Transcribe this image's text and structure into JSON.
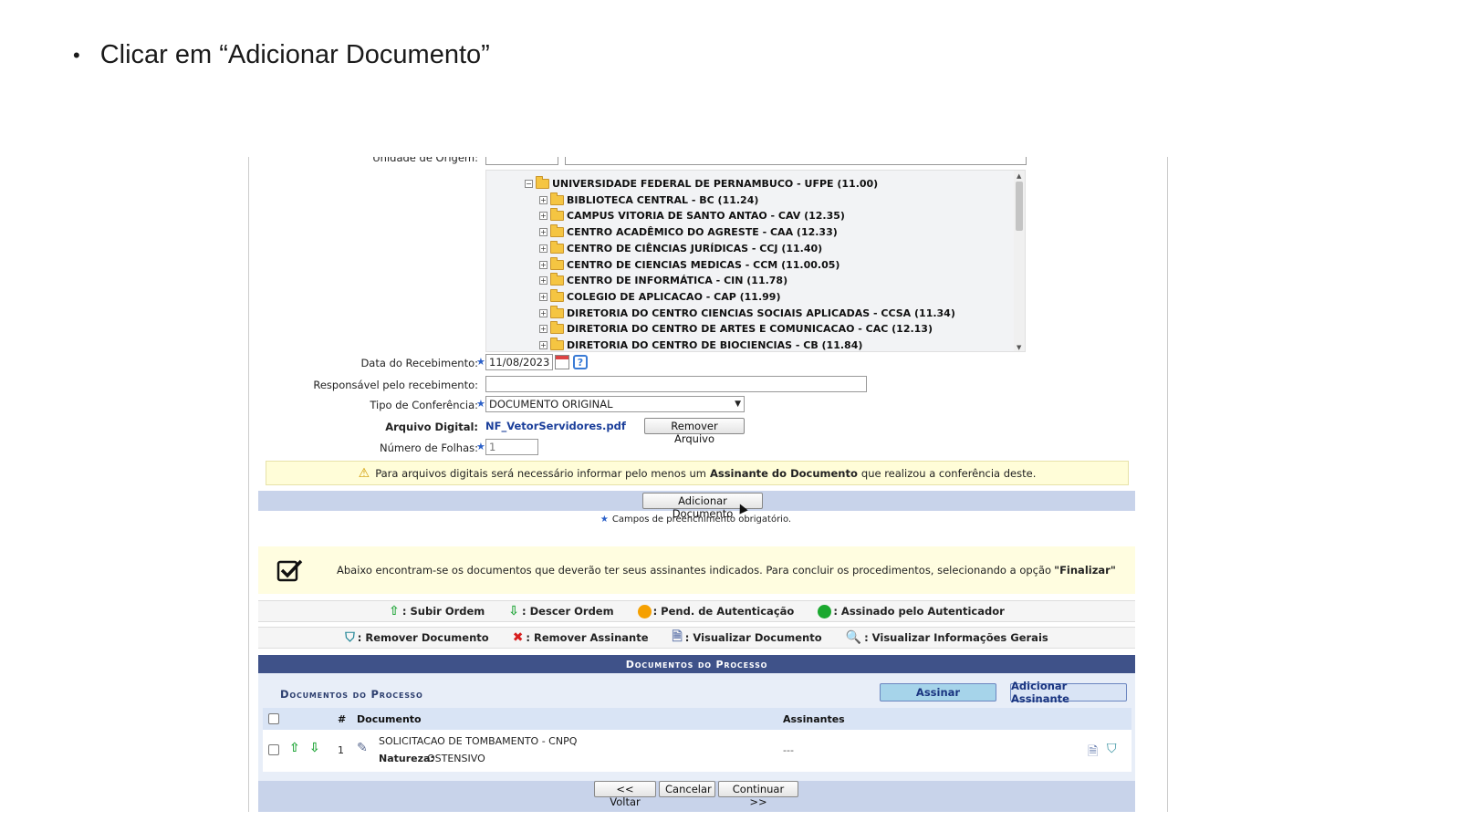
{
  "slide": {
    "bullet_text": "Clicar em “Adicionar Documento”"
  },
  "form": {
    "unidade_origem_label": "Unidade de Origem:",
    "tree": [
      {
        "label": "UNIVERSIDADE FEDERAL DE PERNAMBUCO - UFPE (11.00)",
        "level": 0,
        "expander": "−"
      },
      {
        "label": "BIBLIOTECA CENTRAL - BC (11.24)",
        "level": 1,
        "expander": "+"
      },
      {
        "label": "CAMPUS VITORIA DE SANTO ANTAO - CAV (12.35)",
        "level": 1,
        "expander": "+"
      },
      {
        "label": "CENTRO ACADÊMICO DO AGRESTE - CAA (12.33)",
        "level": 1,
        "expander": "+"
      },
      {
        "label": "CENTRO DE CIÊNCIAS JURÍDICAS - CCJ (11.40)",
        "level": 1,
        "expander": "+"
      },
      {
        "label": "CENTRO DE CIENCIAS MEDICAS - CCM (11.00.05)",
        "level": 1,
        "expander": "+"
      },
      {
        "label": "CENTRO DE INFORMÁTICA - CIN (11.78)",
        "level": 1,
        "expander": "+"
      },
      {
        "label": "COLEGIO DE APLICACAO - CAP (11.99)",
        "level": 1,
        "expander": "+"
      },
      {
        "label": "DIRETORIA DO CENTRO CIENCIAS SOCIAIS APLICADAS - CCSA (11.34)",
        "level": 1,
        "expander": "+"
      },
      {
        "label": "DIRETORIA DO CENTRO DE ARTES E COMUNICACAO - CAC (12.13)",
        "level": 1,
        "expander": "+"
      },
      {
        "label": "DIRETORIA DO CENTRO DE BIOCIENCIAS - CB (11.84)",
        "level": 1,
        "expander": "+"
      }
    ],
    "data_recebimento_label": "Data do Recebimento:",
    "data_recebimento_value": "11/08/2023",
    "responsavel_label": "Responsável pelo recebimento:",
    "responsavel_value": "",
    "tipo_conferencia_label": "Tipo de Conferência:",
    "tipo_conferencia_value": "DOCUMENTO ORIGINAL",
    "arquivo_label": "Arquivo Digital:",
    "arquivo_value": "NF_VetorServidores.pdf",
    "remover_arquivo_label": "Remover Arquivo",
    "num_folhas_label": "Número de Folhas:",
    "num_folhas_value": "1",
    "warning_pre": "Para arquivos digitais será necessário informar pelo menos um",
    "warning_bold": "Assinante do Documento",
    "warning_post": "que realizou a conferência deste.",
    "adicionar_documento_label": "Adicionar Documento",
    "required_note": "Campos de preenchimento obrigatório."
  },
  "info": {
    "text_pre": "Abaixo encontram-se os documentos que deverão ter seus assinantes indicados. Para concluir os procedimentos, selecionando a opção",
    "text_bold": "\"Finalizar\""
  },
  "legend1": {
    "subir": ": Subir Ordem",
    "descer": ": Descer Ordem",
    "pend": ": Pend. de Autenticação",
    "assinado": ": Assinado pelo Autenticador"
  },
  "legend2": {
    "remover_doc": ": Remover Documento",
    "remover_ass": ": Remover Assinante",
    "visualizar_doc": ": Visualizar Documento",
    "visualizar_info": ": Visualizar Informações Gerais"
  },
  "documents": {
    "header": "Documentos do Processo",
    "subtitle": "Documentos do Processo",
    "assinar_label": "Assinar",
    "adicionar_assinante_label": "Adicionar Assinante",
    "columns": {
      "num": "#",
      "documento": "Documento",
      "assinantes": "Assinantes"
    },
    "rows": [
      {
        "num": "1",
        "title": "SOLICITACAO DE TOMBAMENTO - CNPQ",
        "natureza_label": "Natureza:",
        "natureza_value": "OSTENSIVO",
        "assinantes": "---"
      }
    ]
  },
  "footer": {
    "voltar": "<< Voltar",
    "cancelar": "Cancelar",
    "continuar": "Continuar >>"
  },
  "colors": {
    "header_blue": "#3f5289",
    "action_bar": "#c8d3ea",
    "warning_bg": "#fffdd8"
  }
}
